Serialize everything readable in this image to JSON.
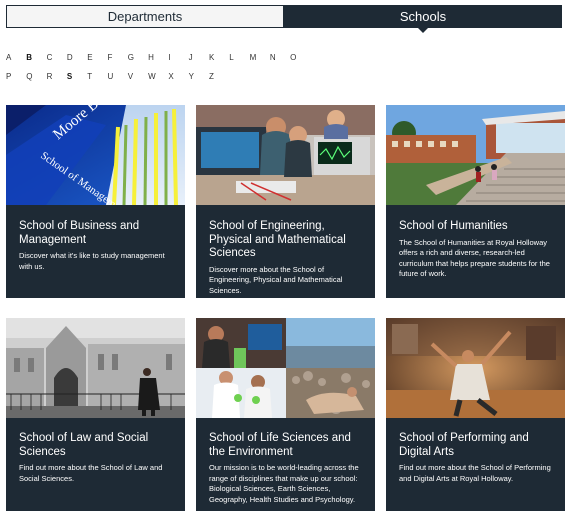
{
  "tabs": [
    {
      "label": "Departments",
      "active": false
    },
    {
      "label": "Schools",
      "active": true
    }
  ],
  "alphabet": {
    "row1": [
      "A",
      "B",
      "C",
      "D",
      "E",
      "F",
      "G",
      "H",
      "I",
      "J",
      "K",
      "L",
      "M",
      "N",
      "O"
    ],
    "row2": [
      "P",
      "Q",
      "R",
      "S",
      "T",
      "U",
      "V",
      "W",
      "X",
      "Y",
      "Z"
    ],
    "bold_letters": [
      "B",
      "S"
    ]
  },
  "cards": [
    {
      "title": "School of Business and Management",
      "description": "Discover what it's like to study management with us.",
      "image_text_1": "Moore Buil",
      "image_text_2": "School of Management"
    },
    {
      "title": "School of Engineering, Physical and Mathematical Sciences",
      "description": "Discover more about the School of Engineering, Physical and Mathematical Sciences."
    },
    {
      "title": "School of Humanities",
      "description": "The School of Humanities at Royal Holloway offers a rich and diverse, research-led curriculum that helps prepare students for the future of work."
    },
    {
      "title": "School of Law and Social Sciences",
      "description": "Find out more about the School of Law and Social Sciences."
    },
    {
      "title": "School of Life Sciences and the Environment",
      "description": "Our mission is to be world-leading across the range of disciplines that make up our school: Biological Sciences, Earth Sciences, Geography, Health Studies and Psychology."
    },
    {
      "title": "School of Performing and Digital Arts",
      "description": "Find out more about the School of Performing and Digital Arts at Royal Holloway."
    }
  ],
  "colors": {
    "navy": "#1e2a35",
    "tab_inactive_bg": "#f5f5f5"
  }
}
